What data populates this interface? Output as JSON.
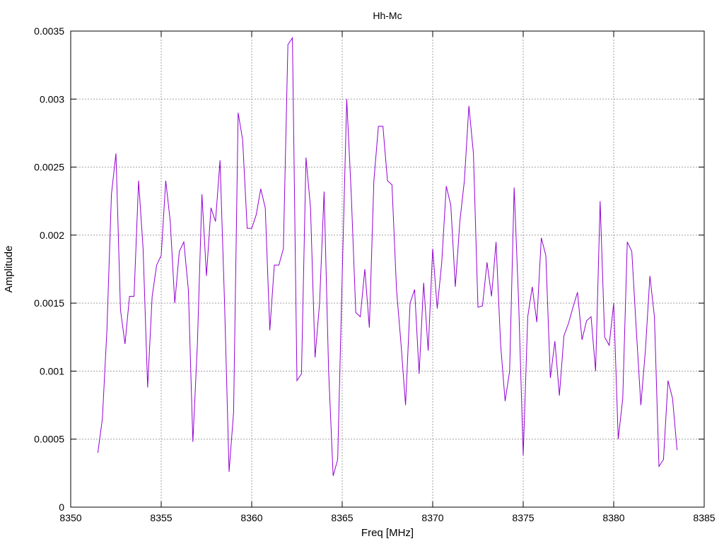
{
  "chart_data": {
    "type": "line",
    "title": "Hh-Mc",
    "xlabel": "Freq [MHz]",
    "ylabel": "Amplitude",
    "xlim": [
      8350,
      8385
    ],
    "ylim": [
      0,
      0.0035
    ],
    "x_ticks": [
      "8350",
      "8355",
      "8360",
      "8365",
      "8370",
      "8375",
      "8380",
      "8385"
    ],
    "y_ticks": [
      "0",
      "0.0005",
      "0.001",
      "0.0015",
      "0.002",
      "0.0025",
      "0.003",
      "0.0035"
    ],
    "grid": true,
    "line_color": "#9400D3",
    "series": [
      {
        "x": [
          8351.5,
          8351.75,
          8352.0,
          8352.25,
          8352.5,
          8352.75,
          8353.0,
          8353.25,
          8353.5,
          8353.75,
          8354.0,
          8354.25,
          8354.5,
          8354.75,
          8355.0,
          8355.25,
          8355.5,
          8355.75,
          8356.0,
          8356.25,
          8356.5,
          8356.75,
          8357.0,
          8357.25,
          8357.5,
          8357.75,
          8358.0,
          8358.25,
          8358.5,
          8358.75,
          8359.0,
          8359.25,
          8359.5,
          8359.75,
          8360.0,
          8360.25,
          8360.5,
          8360.75,
          8361.0,
          8361.25,
          8361.5,
          8361.75,
          8362.0,
          8362.25,
          8362.5,
          8362.75,
          8363.0,
          8363.25,
          8363.5,
          8363.75,
          8364.0,
          8364.25,
          8364.5,
          8364.75,
          8365.0,
          8365.25,
          8365.5,
          8365.75,
          8366.0,
          8366.25,
          8366.5,
          8366.75,
          8367.0,
          8367.25,
          8367.5,
          8367.75,
          8368.0,
          8368.25,
          8368.5,
          8368.75,
          8369.0,
          8369.25,
          8369.5,
          8369.75,
          8370.0,
          8370.25,
          8370.5,
          8370.75,
          8371.0,
          8371.25,
          8371.5,
          8371.75,
          8372.0,
          8372.25,
          8372.5,
          8372.75,
          8373.0,
          8373.25,
          8373.5,
          8373.75,
          8374.0,
          8374.25,
          8374.5,
          8374.75,
          8375.0,
          8375.25,
          8375.5,
          8375.75,
          8376.0,
          8376.25,
          8376.5,
          8376.75,
          8377.0,
          8377.25,
          8377.5,
          8377.75,
          8378.0,
          8378.25,
          8378.5,
          8378.75,
          8379.0,
          8379.25,
          8379.5,
          8379.75,
          8380.0,
          8380.25,
          8380.5,
          8380.75,
          8381.0,
          8381.25,
          8381.5,
          8381.75,
          8382.0,
          8382.25,
          8382.5,
          8382.75,
          8383.0,
          8383.25,
          8383.5
        ],
        "values": [
          0.0004,
          0.00065,
          0.0013,
          0.0023,
          0.0026,
          0.00145,
          0.0012,
          0.00155,
          0.00155,
          0.0024,
          0.0019,
          0.00088,
          0.00155,
          0.00178,
          0.00185,
          0.0024,
          0.0021,
          0.0015,
          0.00188,
          0.00195,
          0.0016,
          0.00048,
          0.0012,
          0.0023,
          0.0017,
          0.0022,
          0.0021,
          0.00255,
          0.0015,
          0.00026,
          0.0007,
          0.0029,
          0.0027,
          0.00205,
          0.00205,
          0.00215,
          0.00234,
          0.0022,
          0.0013,
          0.00178,
          0.00178,
          0.0019,
          0.0034,
          0.00345,
          0.00093,
          0.00098,
          0.00257,
          0.0022,
          0.0011,
          0.0015,
          0.00232,
          0.001,
          0.00023,
          0.00035,
          0.0017,
          0.003,
          0.0023,
          0.00143,
          0.0014,
          0.00175,
          0.00132,
          0.0024,
          0.0028,
          0.0028,
          0.0024,
          0.00237,
          0.0016,
          0.0012,
          0.00075,
          0.0015,
          0.0016,
          0.00098,
          0.00165,
          0.00115,
          0.0019,
          0.00146,
          0.0018,
          0.00236,
          0.00222,
          0.00162,
          0.0021,
          0.0024,
          0.00295,
          0.0026,
          0.00147,
          0.00148,
          0.0018,
          0.00155,
          0.00195,
          0.0012,
          0.00078,
          0.001,
          0.00235,
          0.0015,
          0.00038,
          0.0014,
          0.00162,
          0.00136,
          0.00198,
          0.00185,
          0.00095,
          0.00122,
          0.00082,
          0.00126,
          0.00135,
          0.00147,
          0.00158,
          0.00123,
          0.00137,
          0.0014,
          0.001,
          0.00225,
          0.00125,
          0.00119,
          0.0015,
          0.0005,
          0.0008,
          0.00195,
          0.00188,
          0.0013,
          0.00075,
          0.00115,
          0.0017,
          0.0014,
          0.0003,
          0.00035,
          0.00093,
          0.0008,
          0.00042
        ]
      }
    ]
  }
}
